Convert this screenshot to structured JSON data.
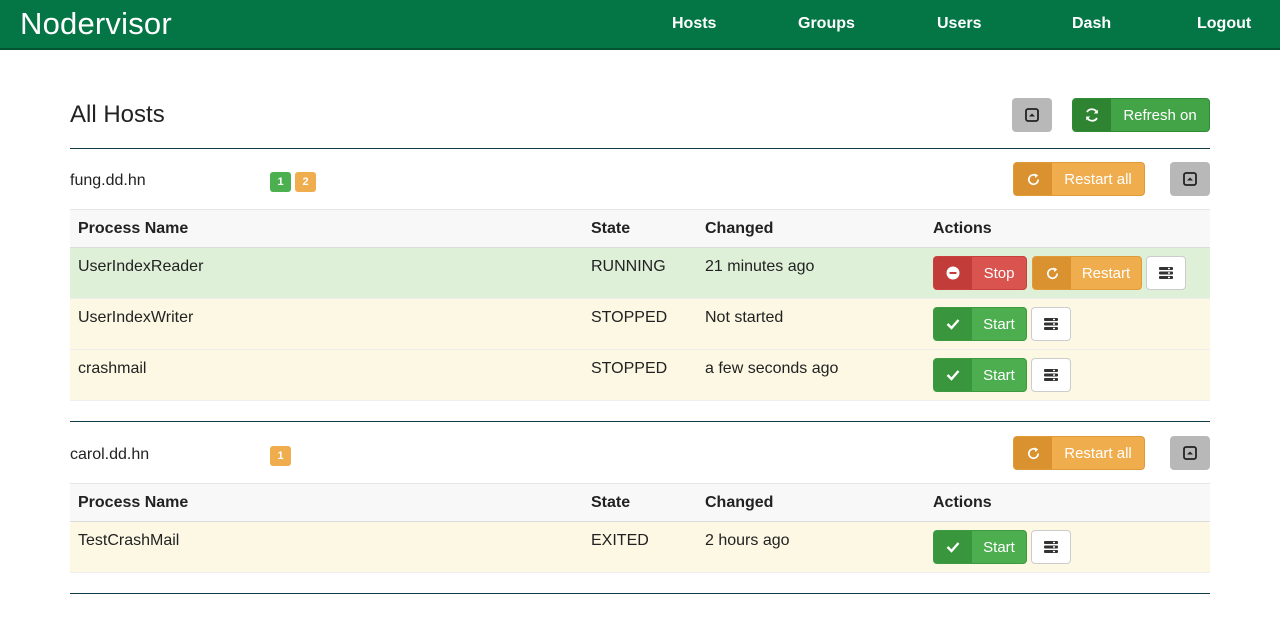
{
  "app": {
    "brand": "Nodervisor"
  },
  "nav": {
    "items": [
      "Hosts",
      "Groups",
      "Users",
      "Dash",
      "Logout"
    ]
  },
  "page": {
    "title": "All Hosts",
    "refresh_label": "Refresh on",
    "icons": {
      "refresh": "refresh-icon",
      "collapse": "collapse-icon"
    }
  },
  "table_headers": {
    "name": "Process Name",
    "state": "State",
    "changed": "Changed",
    "actions": "Actions"
  },
  "labels": {
    "restart_all": "Restart all",
    "stop": "Stop",
    "restart": "Restart",
    "start": "Start"
  },
  "colors": {
    "navbar": "#047545",
    "success": "#4cae4f",
    "warning": "#f0ad4e",
    "danger": "#d9534f",
    "running_row": "#dff0d8",
    "stopped_row": "#fcf8e3"
  },
  "hosts": [
    {
      "name": "fung.dd.hn",
      "badges": [
        {
          "value": "1",
          "color": "green"
        },
        {
          "value": "2",
          "color": "orange"
        }
      ],
      "processes": [
        {
          "name": "UserIndexReader",
          "state": "RUNNING",
          "changed": "21 minutes ago"
        },
        {
          "name": "UserIndexWriter",
          "state": "STOPPED",
          "changed": "Not started"
        },
        {
          "name": "crashmail",
          "state": "STOPPED",
          "changed": "a few seconds ago"
        }
      ]
    },
    {
      "name": "carol.dd.hn",
      "badges": [
        {
          "value": "1",
          "color": "orange"
        }
      ],
      "processes": [
        {
          "name": "TestCrashMail",
          "state": "EXITED",
          "changed": "2 hours ago"
        }
      ]
    }
  ]
}
